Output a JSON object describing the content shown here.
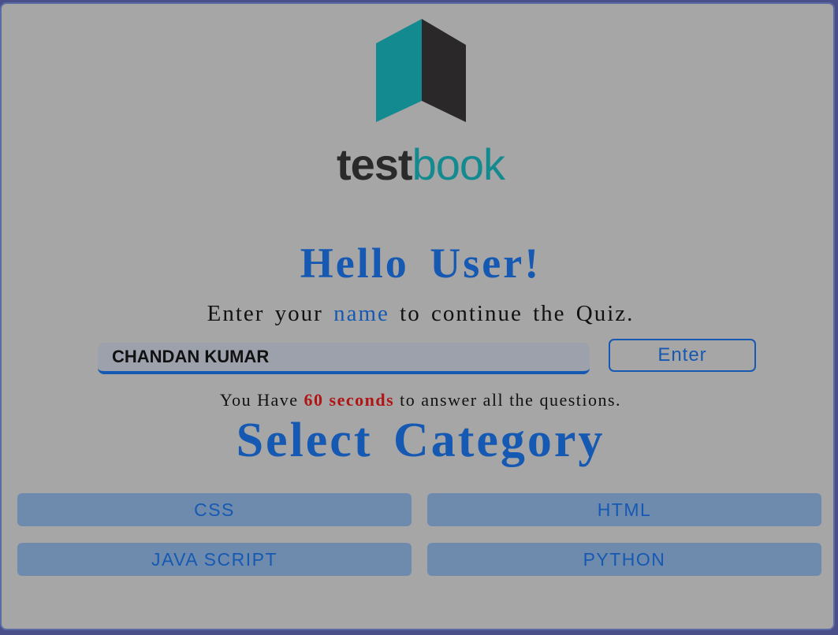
{
  "logo": {
    "text_part1": "test",
    "text_part2": "book",
    "colors": {
      "teal": "#138a90",
      "dark": "#2a2a2a"
    }
  },
  "greeting": {
    "title": "Hello User!",
    "instruction_before": "Enter your",
    "instruction_highlight": "name",
    "instruction_after": "to continue the Quiz."
  },
  "name_input": {
    "value": "CHANDAN KUMAR"
  },
  "enter_button": {
    "label": "Enter"
  },
  "timer_note": {
    "before": "You Have",
    "seconds": "60 seconds",
    "after": "to answer all the questions."
  },
  "category": {
    "heading": "Select Category",
    "options": [
      "CSS",
      "HTML",
      "JAVA SCRIPT",
      "PYTHON"
    ]
  },
  "colors": {
    "accent": "#1559b3",
    "background": "#a6a6a6",
    "category_button": "#6e8bae",
    "seconds_red": "#b01414"
  }
}
